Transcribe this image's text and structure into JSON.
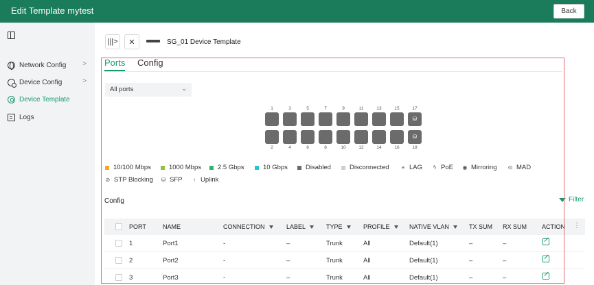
{
  "header": {
    "title": "Edit Template mytest",
    "back_label": "Back"
  },
  "sidebar": {
    "items": [
      {
        "label": "Network Config",
        "icon": "globe-icon",
        "chevron": ">"
      },
      {
        "label": "Device Config",
        "icon": "device-config-icon",
        "chevron": ">"
      },
      {
        "label": "Device Template",
        "icon": "device-template-icon",
        "active": true
      },
      {
        "label": "Logs",
        "icon": "logs-icon"
      }
    ]
  },
  "toolbar": {
    "expand_glyph": "|||>",
    "close_glyph": "✕",
    "device_title": "SG_01 Device Template"
  },
  "tabs": [
    {
      "label": "Ports",
      "active": true
    },
    {
      "label": "Config",
      "active": false
    }
  ],
  "port_filter": {
    "value": "All ports",
    "chevron": "⌄"
  },
  "ports": {
    "top_numbers": [
      "1",
      "3",
      "5",
      "7",
      "9",
      "11",
      "13",
      "15",
      "17"
    ],
    "bottom_numbers": [
      "2",
      "4",
      "6",
      "8",
      "10",
      "12",
      "14",
      "16",
      "18"
    ],
    "sfp_glyph": "⛁",
    "port_color": "#6b6b6b"
  },
  "legend": {
    "row1": [
      {
        "label": "10/100 Mbps",
        "color": "#f5a623",
        "kind": "swatch"
      },
      {
        "label": "1000 Mbps",
        "color": "#8bc34a",
        "kind": "swatch"
      },
      {
        "label": "2.5 Gbps",
        "color": "#2bb673",
        "kind": "swatch"
      },
      {
        "label": "10 Gbps",
        "color": "#1ec8d6",
        "kind": "swatch"
      },
      {
        "label": "Disabled",
        "color": "#6b6b6b",
        "kind": "swatch"
      },
      {
        "label": "Disconnected",
        "color": "#cfcfcf",
        "kind": "swatch"
      },
      {
        "label": "LAG",
        "glyph": "≡",
        "kind": "icon"
      },
      {
        "label": "PoE",
        "glyph": "ϟ",
        "kind": "icon"
      },
      {
        "label": "Mirroring",
        "glyph": "◉",
        "kind": "icon"
      },
      {
        "label": "MAD",
        "glyph": "⊙",
        "kind": "icon"
      }
    ],
    "row2": [
      {
        "label": "STP Blocking",
        "glyph": "⊘",
        "kind": "icon"
      },
      {
        "label": "SFP",
        "glyph": "⛁",
        "kind": "icon"
      },
      {
        "label": "Uplink",
        "glyph": "↑",
        "kind": "icon"
      }
    ]
  },
  "config_section": {
    "label": "Config",
    "filter_label": "Filter"
  },
  "table": {
    "columns": [
      "PORT",
      "NAME",
      "CONNECTION",
      "LABEL",
      "TYPE",
      "PROFILE",
      "NATIVE VLAN",
      "TX SUM",
      "RX SUM",
      "ACTION"
    ],
    "kebab": "⋮",
    "rows": [
      {
        "port": "1",
        "name": "Port1",
        "connection": "-",
        "label": "–",
        "type": "Trunk",
        "profile": "All",
        "native_vlan": "Default(1)",
        "tx": "–",
        "rx": "–"
      },
      {
        "port": "2",
        "name": "Port2",
        "connection": "-",
        "label": "–",
        "type": "Trunk",
        "profile": "All",
        "native_vlan": "Default(1)",
        "tx": "–",
        "rx": "–"
      },
      {
        "port": "3",
        "name": "Port3",
        "connection": "-",
        "label": "–",
        "type": "Trunk",
        "profile": "All",
        "native_vlan": "Default(1)",
        "tx": "–",
        "rx": "–"
      }
    ]
  },
  "colors": {
    "brand": "#1a7c5a",
    "accent": "#1a9a6c",
    "frame": "#e06c75"
  }
}
